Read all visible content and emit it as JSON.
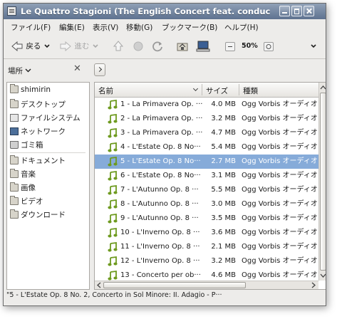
{
  "window": {
    "title": "Le Quattro Stagioni (The English Concert feat. conductor: Trevor Pinnock)"
  },
  "menubar": {
    "items": [
      "ファイル(F)",
      "編集(E)",
      "表示(V)",
      "移動(G)",
      "ブックマーク(B)",
      "ヘルプ(H)"
    ]
  },
  "toolbar": {
    "back_label": "戻る",
    "forward_label": "進む",
    "zoom_value": "50%"
  },
  "location": {
    "places_label": "場所"
  },
  "sidebar": {
    "items": [
      {
        "label": "shimirin",
        "icon": "home-folder-icon"
      },
      {
        "label": "デスクトップ",
        "icon": "desktop-folder-icon"
      },
      {
        "label": "ファイルシステム",
        "icon": "filesystem-icon"
      },
      {
        "label": "ネットワーク",
        "icon": "network-icon"
      },
      {
        "label": "ゴミ箱",
        "icon": "trash-icon"
      },
      {
        "label": "ドキュメント",
        "icon": "documents-folder-icon"
      },
      {
        "label": "音楽",
        "icon": "music-folder-icon"
      },
      {
        "label": "画像",
        "icon": "pictures-folder-icon"
      },
      {
        "label": "ビデオ",
        "icon": "videos-folder-icon"
      },
      {
        "label": "ダウンロード",
        "icon": "downloads-folder-icon"
      }
    ]
  },
  "filelist": {
    "columns": {
      "name": "名前",
      "size": "サイズ",
      "type": "種類"
    },
    "selected_index": 4,
    "rows": [
      {
        "name": "1 - La Primavera Op. ···",
        "size": "4.0 MB",
        "type": "Ogg Vorbis オーディオ"
      },
      {
        "name": "2 - La Primavera Op. ···",
        "size": "3.2 MB",
        "type": "Ogg Vorbis オーディオ"
      },
      {
        "name": "3 - La Primavera Op. ···",
        "size": "4.7 MB",
        "type": "Ogg Vorbis オーディオ"
      },
      {
        "name": "4 - L'Estate Op. 8 No···",
        "size": "5.4 MB",
        "type": "Ogg Vorbis オーディオ"
      },
      {
        "name": "5 - L'Estate Op. 8 No···",
        "size": "2.7 MB",
        "type": "Ogg Vorbis オーディオ"
      },
      {
        "name": "6 - L'Estate Op. 8 No···",
        "size": "3.1 MB",
        "type": "Ogg Vorbis オーディオ"
      },
      {
        "name": "7 - L'Autunno Op. 8 ···",
        "size": "5.5 MB",
        "type": "Ogg Vorbis オーディオ"
      },
      {
        "name": "8 - L'Autunno Op. 8 ···",
        "size": "3.0 MB",
        "type": "Ogg Vorbis オーディオ"
      },
      {
        "name": "9 - L'Autunno Op. 8 ···",
        "size": "3.5 MB",
        "type": "Ogg Vorbis オーディオ"
      },
      {
        "name": "10 - L'Inverno Op. 8 ···",
        "size": "3.6 MB",
        "type": "Ogg Vorbis オーディオ"
      },
      {
        "name": "11 - L'Inverno Op. 8 ···",
        "size": "2.1 MB",
        "type": "Ogg Vorbis オーディオ"
      },
      {
        "name": "12 - L'Inverno Op. 8 ···",
        "size": "3.2 MB",
        "type": "Ogg Vorbis オーディオ"
      },
      {
        "name": "13 - Concerto per ob···",
        "size": "4.6 MB",
        "type": "Ogg Vorbis オーディオ"
      }
    ]
  },
  "status": {
    "text": "\"5 - L'Estate Op. 8 No. 2, Concerto in Sol Minore: II. Adagio - P···"
  },
  "colors": {
    "selection": "#86abd9",
    "titlebar": "#6b7f9b",
    "music_icon": "#6e9a1f"
  }
}
